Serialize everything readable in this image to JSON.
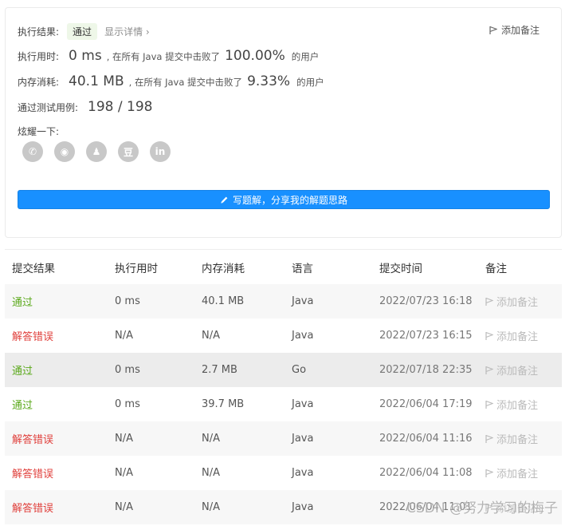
{
  "result": {
    "label": "执行结果:",
    "status": "通过",
    "detail_link": "显示详情 ›",
    "add_remark": "添加备注"
  },
  "runtime": {
    "label": "执行用时:",
    "value": "0 ms",
    "mid": ", 在所有 Java 提交中击败了",
    "percent": "100.00%",
    "tail": "的用户"
  },
  "memory": {
    "label": "内存消耗:",
    "value": "40.1 MB",
    "mid": ", 在所有 Java 提交中击败了",
    "percent": "9.33%",
    "tail": "的用户"
  },
  "testcases": {
    "label": "通过测试用例:",
    "value": "198 / 198"
  },
  "share": {
    "label": "炫耀一下:",
    "icons": [
      {
        "name": "wechat-icon",
        "glyph": "✆"
      },
      {
        "name": "weibo-icon",
        "glyph": "◉"
      },
      {
        "name": "qq-icon",
        "glyph": "♟"
      },
      {
        "name": "douban-icon",
        "glyph": "豆"
      },
      {
        "name": "linkedin-icon",
        "glyph": "in"
      }
    ]
  },
  "write_button": "写题解，分享我的解题思路",
  "table": {
    "headers": [
      "提交结果",
      "执行用时",
      "内存消耗",
      "语言",
      "提交时间",
      "备注"
    ],
    "rows": [
      {
        "status": "通过",
        "pass": true,
        "time": "0 ms",
        "memory": "40.1 MB",
        "lang": "Java",
        "submitted": "2022/07/23 16:18",
        "remark": "添加备注"
      },
      {
        "status": "解答错误",
        "pass": false,
        "time": "N/A",
        "memory": "N/A",
        "lang": "Java",
        "submitted": "2022/07/23 16:15",
        "remark": "添加备注"
      },
      {
        "status": "通过",
        "pass": true,
        "time": "0 ms",
        "memory": "2.7 MB",
        "lang": "Go",
        "submitted": "2022/07/18 22:35",
        "remark": "添加备注"
      },
      {
        "status": "通过",
        "pass": true,
        "time": "0 ms",
        "memory": "39.7 MB",
        "lang": "Java",
        "submitted": "2022/06/04 17:19",
        "remark": "添加备注"
      },
      {
        "status": "解答错误",
        "pass": false,
        "time": "N/A",
        "memory": "N/A",
        "lang": "Java",
        "submitted": "2022/06/04 11:16",
        "remark": "添加备注"
      },
      {
        "status": "解答错误",
        "pass": false,
        "time": "N/A",
        "memory": "N/A",
        "lang": "Java",
        "submitted": "2022/06/04 11:08",
        "remark": "添加备注"
      },
      {
        "status": "解答错误",
        "pass": false,
        "time": "N/A",
        "memory": "N/A",
        "lang": "Java",
        "submitted": "2022/06/04 11:01",
        "remark": "添加备注"
      }
    ]
  },
  "watermark": "CSDN @努力学习的梅子",
  "colors": {
    "pass": "#5ba91b",
    "fail": "#e0403c",
    "primary_button": "#1890ff"
  }
}
